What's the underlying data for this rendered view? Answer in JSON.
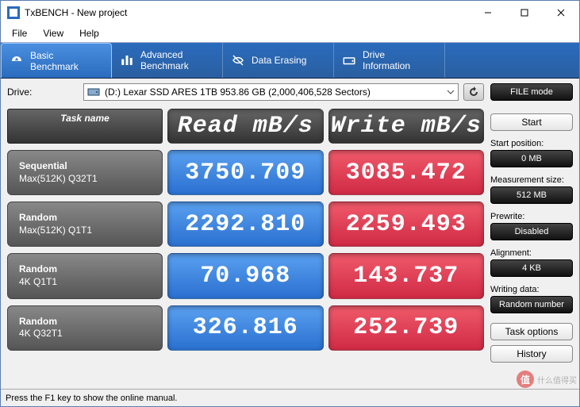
{
  "window": {
    "title": "TxBENCH - New project"
  },
  "menu": {
    "file": "File",
    "view": "View",
    "help": "Help"
  },
  "tabs": {
    "basic": "Basic\nBenchmark",
    "advanced": "Advanced\nBenchmark",
    "erase": "Data Erasing",
    "drive": "Drive\nInformation"
  },
  "drive": {
    "label": "Drive:",
    "selected": "(D:) Lexar SSD ARES 1TB  953.86 GB (2,000,406,528 Sectors)"
  },
  "headers": {
    "task": "Task name",
    "read": "Read mB/s",
    "write": "Write mB/s"
  },
  "results": [
    {
      "name1": "Sequential",
      "name2": "Max(512K) Q32T1",
      "read": "3750.709",
      "write": "3085.472"
    },
    {
      "name1": "Random",
      "name2": "Max(512K) Q1T1",
      "read": "2292.810",
      "write": "2259.493"
    },
    {
      "name1": "Random",
      "name2": "4K Q1T1",
      "read": "70.968",
      "write": "143.737"
    },
    {
      "name1": "Random",
      "name2": "4K Q32T1",
      "read": "326.816",
      "write": "252.739"
    }
  ],
  "side": {
    "filemode": "FILE mode",
    "start": "Start",
    "startpos_lbl": "Start position:",
    "startpos": "0 MB",
    "meassize_lbl": "Measurement size:",
    "meassize": "512 MB",
    "prewrite_lbl": "Prewrite:",
    "prewrite": "Disabled",
    "align_lbl": "Alignment:",
    "align": "4 KB",
    "wdata_lbl": "Writing data:",
    "wdata": "Random number",
    "taskopt": "Task options",
    "history": "History"
  },
  "status": "Press the F1 key to show the online manual.",
  "watermark": "什么值得买"
}
